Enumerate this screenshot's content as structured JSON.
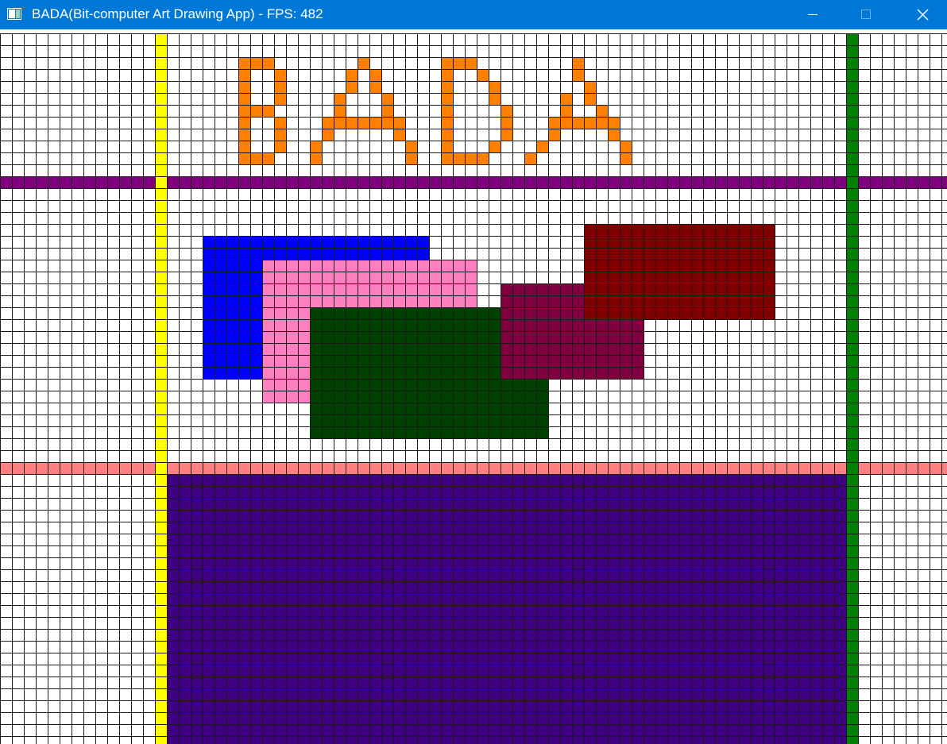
{
  "window": {
    "title": "BADA(Bit-computer Art Drawing App) - FPS: 482",
    "icon": "app-window-icon",
    "controls": [
      {
        "name": "minimize-button",
        "icon": "minimize-icon"
      },
      {
        "name": "maximize-button",
        "icon": "maximize-icon"
      },
      {
        "name": "close-button",
        "icon": "close-icon"
      }
    ]
  },
  "canvas": {
    "grid": true,
    "cell_size_note": "pixel grid",
    "background": "#ffffff",
    "grid_line_color": "#1a1a1a",
    "banner_text": "BADA",
    "banner_color": "#ff7f00",
    "colors": {
      "yellow": "#ffff00",
      "green": "#008000",
      "purple": "#800080",
      "salmon": "#ff8080",
      "indigo": "#3c0080",
      "blue": "#0000ff",
      "pink": "#ff80c0",
      "dark_green": "#004000",
      "maroon": "#800040",
      "dark_red": "#800000"
    }
  }
}
